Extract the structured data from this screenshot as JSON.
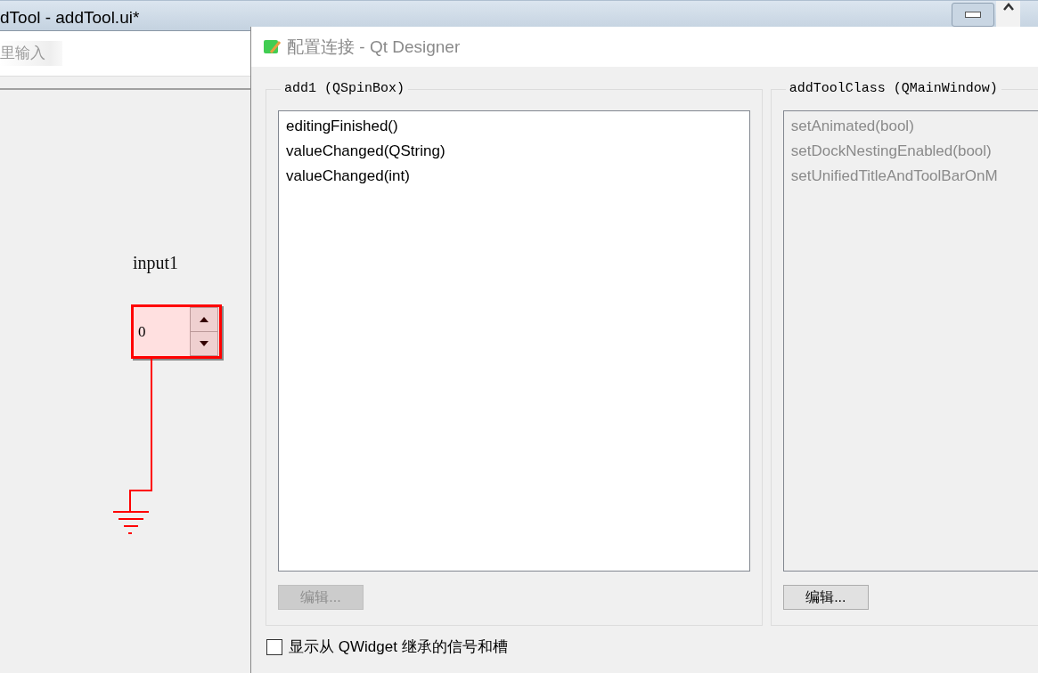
{
  "main_window": {
    "title": "dTool - addTool.ui*",
    "filter_field": {
      "placeholder": "里输入"
    },
    "canvas": {
      "widget_label": "input1",
      "spinbox": {
        "value": "0",
        "selected": true
      }
    }
  },
  "dialog": {
    "title": "配置连接 - Qt Designer",
    "groups": [
      {
        "title": "add1 (QSpinBox)",
        "disabled": false,
        "items": [
          {
            "label": "editingFinished()",
            "selected": false
          },
          {
            "label": "valueChanged(QString)",
            "selected": false
          },
          {
            "label": "valueChanged(int)",
            "selected": false
          }
        ],
        "edit_button": {
          "label": "编辑...",
          "disabled": true
        }
      },
      {
        "title": "addToolClass (QMainWindow)",
        "disabled": true,
        "items": [
          {
            "label": "setAnimated(bool)",
            "selected": false
          },
          {
            "label": "setDockNestingEnabled(bool)",
            "selected": false
          },
          {
            "label": "setUnifiedTitleAndToolBarOnM",
            "selected": false
          }
        ],
        "edit_button": {
          "label": "编辑...",
          "disabled": false
        }
      }
    ],
    "inherit_checkbox": {
      "label": "显示从 QWidget 继承的信号和槽",
      "checked": false
    }
  }
}
